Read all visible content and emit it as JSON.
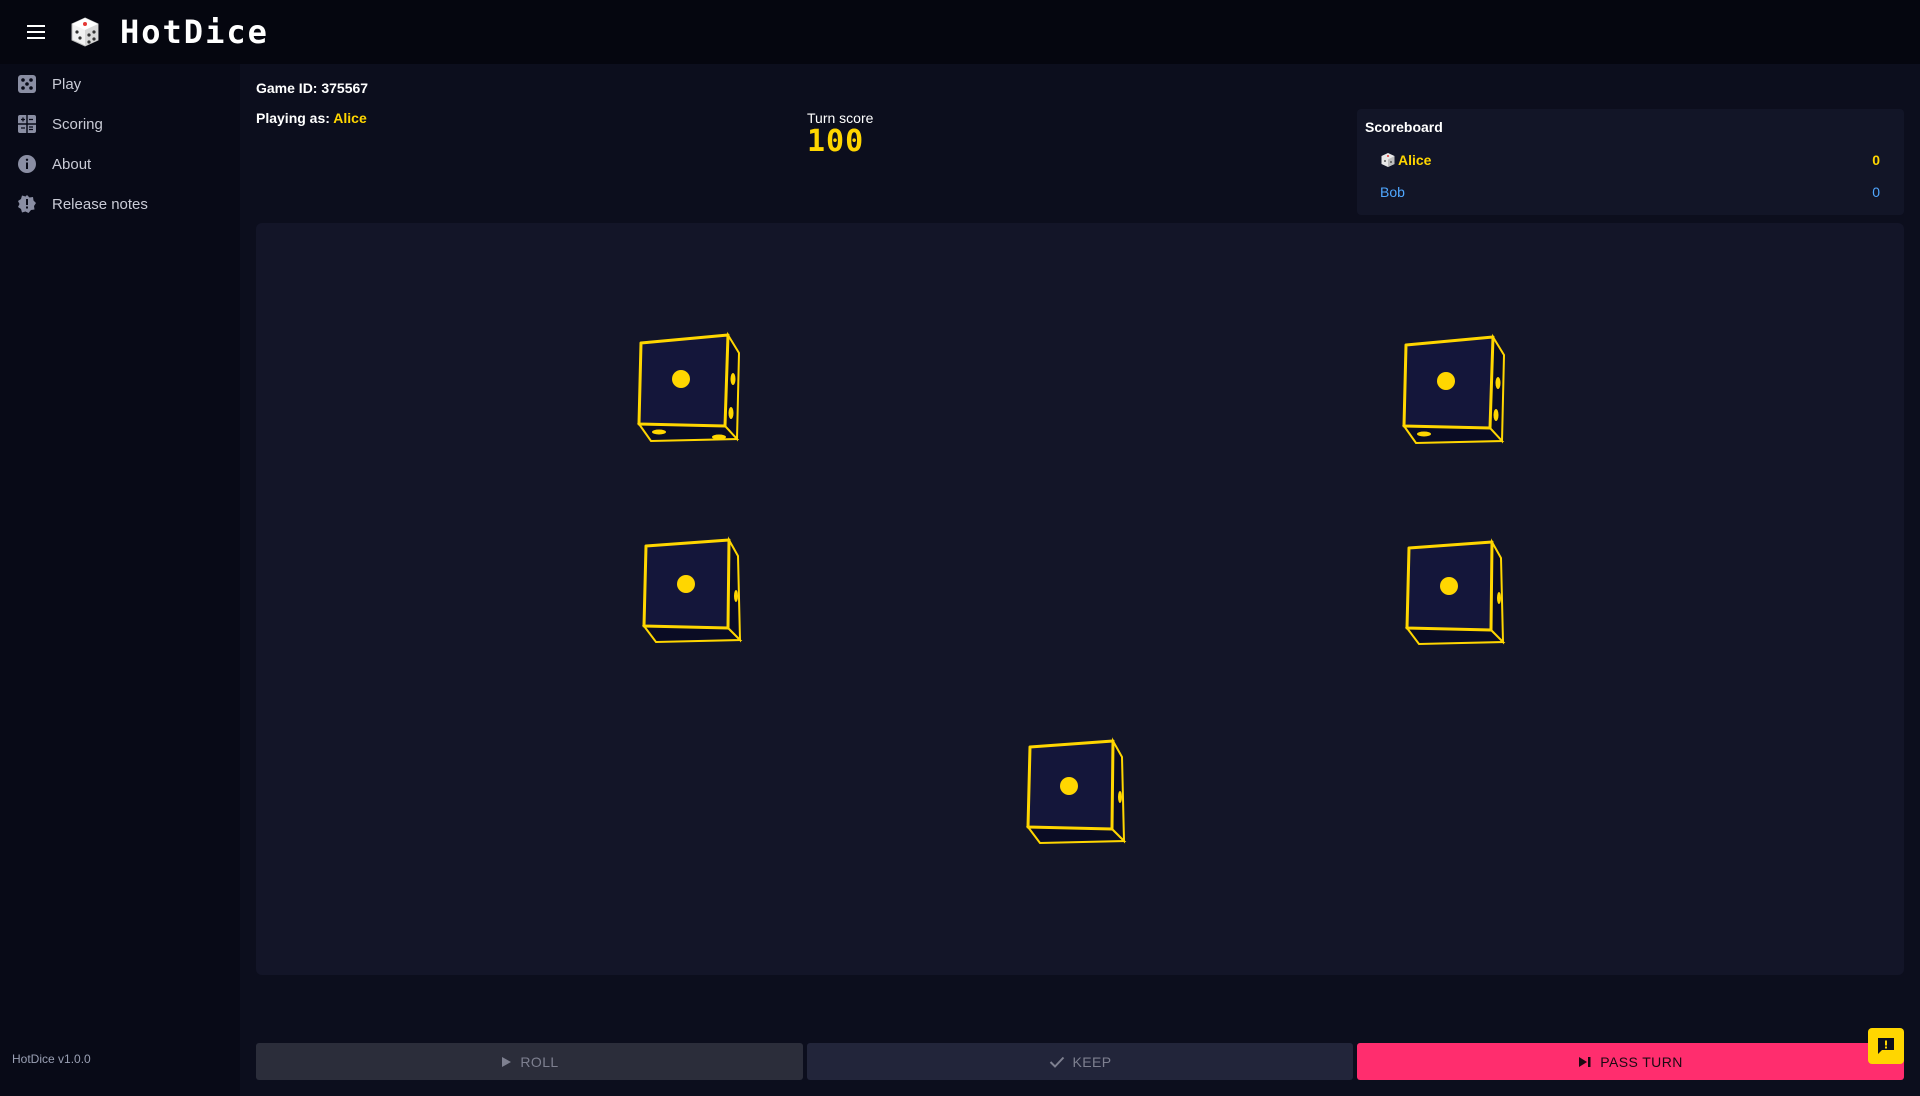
{
  "app": {
    "title": "HotDice",
    "version": "HotDice v1.0.0"
  },
  "nav": {
    "items": [
      {
        "label": "Play",
        "icon": "dice-icon"
      },
      {
        "label": "Scoring",
        "icon": "scoring-grid-icon"
      },
      {
        "label": "About",
        "icon": "info-icon"
      },
      {
        "label": "Release notes",
        "icon": "badge-icon"
      }
    ]
  },
  "game": {
    "id_label": "Game ID: 375567",
    "playing_as_label": "Playing as: ",
    "playing_as_name": "Alice",
    "turn_score_label": "Turn score",
    "turn_score_value": "100"
  },
  "scoreboard": {
    "title": "Scoreboard",
    "players": [
      {
        "name": "Alice",
        "score": "0",
        "color": "#ffd600",
        "active": true
      },
      {
        "name": "Bob",
        "score": "0",
        "color": "#4fa7ff",
        "active": false
      }
    ]
  },
  "dice": [
    {
      "face": 1
    },
    {
      "face": 1
    },
    {
      "face": 1
    },
    {
      "face": 1
    },
    {
      "face": 1
    }
  ],
  "buttons": {
    "roll": "ROLL",
    "keep": "KEEP",
    "pass": "PASS TURN"
  },
  "colors": {
    "accent": "#ffd600",
    "pass_button": "#ff2d6e",
    "board": "#131528",
    "die_fill": "#14163a"
  }
}
